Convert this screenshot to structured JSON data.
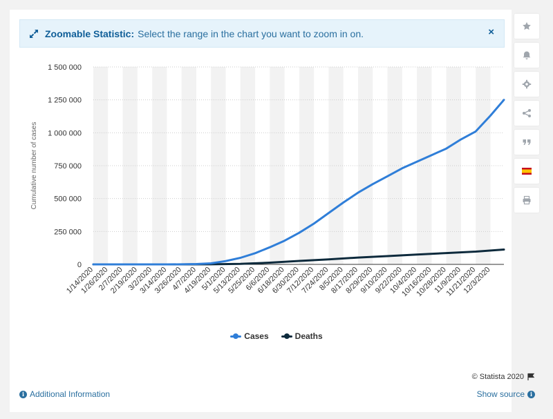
{
  "banner": {
    "label": "Zoomable Statistic:",
    "text": "Select the range in the chart you want to zoom in on.",
    "close_glyph": "×"
  },
  "toolbar": [
    {
      "name": "favorite-star-icon"
    },
    {
      "name": "notification-bell-icon"
    },
    {
      "name": "settings-gear-icon"
    },
    {
      "name": "share-icon"
    },
    {
      "name": "citation-quote-icon"
    },
    {
      "name": "language-flag-es-icon"
    },
    {
      "name": "print-icon"
    }
  ],
  "credit": {
    "text": "© Statista 2020"
  },
  "footer": {
    "additional_info": "Additional Information",
    "show_source": "Show source"
  },
  "colors": {
    "cases": "#2f7ed8",
    "deaths": "#0d2a3c",
    "band": "#f2f2f2",
    "grid": "#cccccc"
  },
  "chart_data": {
    "type": "line",
    "title": "",
    "xlabel": "",
    "ylabel": "Cumulative number of cases",
    "ylim": [
      0,
      1500000
    ],
    "yticks": [
      0,
      250000,
      500000,
      750000,
      1000000,
      1250000,
      1500000
    ],
    "ytick_labels": [
      "0",
      "250 000",
      "500 000",
      "750 000",
      "1 000 000",
      "1 250 000",
      "1 500 000"
    ],
    "x_range": [
      "1/14/2020",
      "12/14/2020"
    ],
    "x_tick_labels": [
      "1/14/2020",
      "1/26/2020",
      "2/7/2020",
      "2/19/2020",
      "3/2/2020",
      "3/14/2020",
      "3/26/2020",
      "4/7/2020",
      "4/19/2020",
      "5/1/2020",
      "5/13/2020",
      "5/25/2020",
      "6/6/2020",
      "6/18/2020",
      "6/30/2020",
      "7/12/2020",
      "7/24/2020",
      "8/5/2020",
      "8/17/2020",
      "8/29/2020",
      "9/10/2020",
      "9/22/2020",
      "10/4/2020",
      "10/16/2020",
      "10/28/2020",
      "11/9/2020",
      "11/21/2020",
      "12/3/2020"
    ],
    "grid": true,
    "legend": "bottom-center",
    "series": [
      {
        "name": "Cases",
        "points": [
          [
            "1/14/2020",
            0
          ],
          [
            "3/14/2020",
            0
          ],
          [
            "3/26/2020",
            500
          ],
          [
            "4/7/2020",
            2500
          ],
          [
            "4/19/2020",
            8000
          ],
          [
            "5/1/2020",
            25000
          ],
          [
            "5/13/2020",
            50000
          ],
          [
            "5/25/2020",
            85000
          ],
          [
            "6/6/2020",
            130000
          ],
          [
            "6/18/2020",
            180000
          ],
          [
            "6/30/2020",
            240000
          ],
          [
            "7/12/2020",
            310000
          ],
          [
            "7/24/2020",
            390000
          ],
          [
            "8/5/2020",
            470000
          ],
          [
            "8/17/2020",
            545000
          ],
          [
            "8/29/2020",
            610000
          ],
          [
            "9/10/2020",
            670000
          ],
          [
            "9/22/2020",
            730000
          ],
          [
            "10/4/2020",
            780000
          ],
          [
            "10/16/2020",
            830000
          ],
          [
            "10/28/2020",
            880000
          ],
          [
            "11/9/2020",
            950000
          ],
          [
            "11/21/2020",
            1010000
          ],
          [
            "12/3/2020",
            1130000
          ],
          [
            "12/14/2020",
            1250000
          ]
        ]
      },
      {
        "name": "Deaths",
        "points": [
          [
            "1/14/2020",
            0
          ],
          [
            "3/26/2020",
            0
          ],
          [
            "4/19/2020",
            500
          ],
          [
            "5/13/2020",
            4000
          ],
          [
            "6/6/2020",
            13000
          ],
          [
            "6/30/2020",
            26000
          ],
          [
            "7/24/2020",
            38000
          ],
          [
            "8/17/2020",
            52000
          ],
          [
            "9/10/2020",
            63000
          ],
          [
            "10/4/2020",
            75000
          ],
          [
            "10/28/2020",
            86000
          ],
          [
            "11/21/2020",
            97000
          ],
          [
            "12/14/2020",
            113000
          ]
        ]
      }
    ]
  }
}
